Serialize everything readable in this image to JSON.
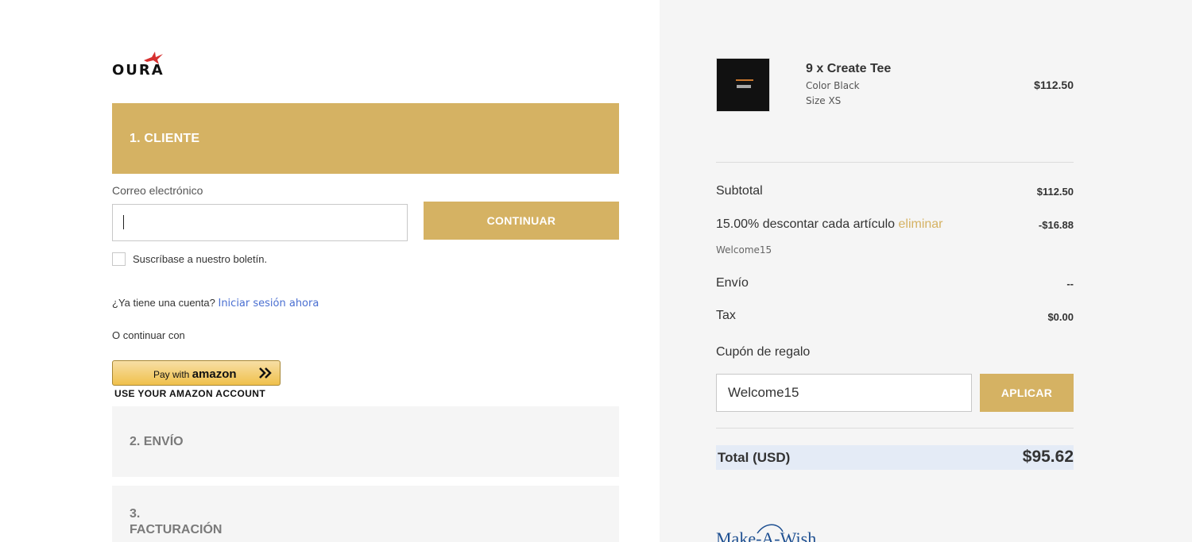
{
  "brand": {
    "name": "OURA",
    "accent_color": "#d5b263"
  },
  "checkout": {
    "step1": {
      "title": "1. CLIENTE"
    },
    "email": {
      "label": "Correo electrónico",
      "value": "",
      "placeholder": ""
    },
    "continue_label": "CONTINUAR",
    "newsletter_label": "Suscríbase a nuestro boletín.",
    "account_question": "¿Ya tiene una cuenta?",
    "signin_label": "Iniciar sesión ahora",
    "or_continue": "O continuar con",
    "amazon": {
      "pay_with": "Pay with",
      "brand": "amazon",
      "caption": "USE YOUR AMAZON ACCOUNT"
    },
    "step2": {
      "title": "2. ENVÍO"
    },
    "step3": {
      "title": "3. FACTURACIÓN"
    }
  },
  "summary": {
    "item": {
      "title": "9 x Create Tee",
      "color": "Color Black",
      "size": "Size XS",
      "price": "$112.50"
    },
    "subtotal": {
      "label": "Subtotal",
      "value": "$112.50"
    },
    "discount": {
      "label": "15.00% descontar cada artículo",
      "remove_label": "eliminar",
      "value": "-$16.88",
      "code": "Welcome15"
    },
    "shipping": {
      "label": "Envío",
      "value": "--"
    },
    "tax": {
      "label": "Tax",
      "value": "$0.00"
    },
    "gift": {
      "label": "Cupón de regalo",
      "value": "Welcome15",
      "apply_label": "APLICAR"
    },
    "total": {
      "label": "Total (USD)",
      "value": "$95.62"
    }
  },
  "footer_logo": {
    "text": "Make-A-Wish"
  }
}
